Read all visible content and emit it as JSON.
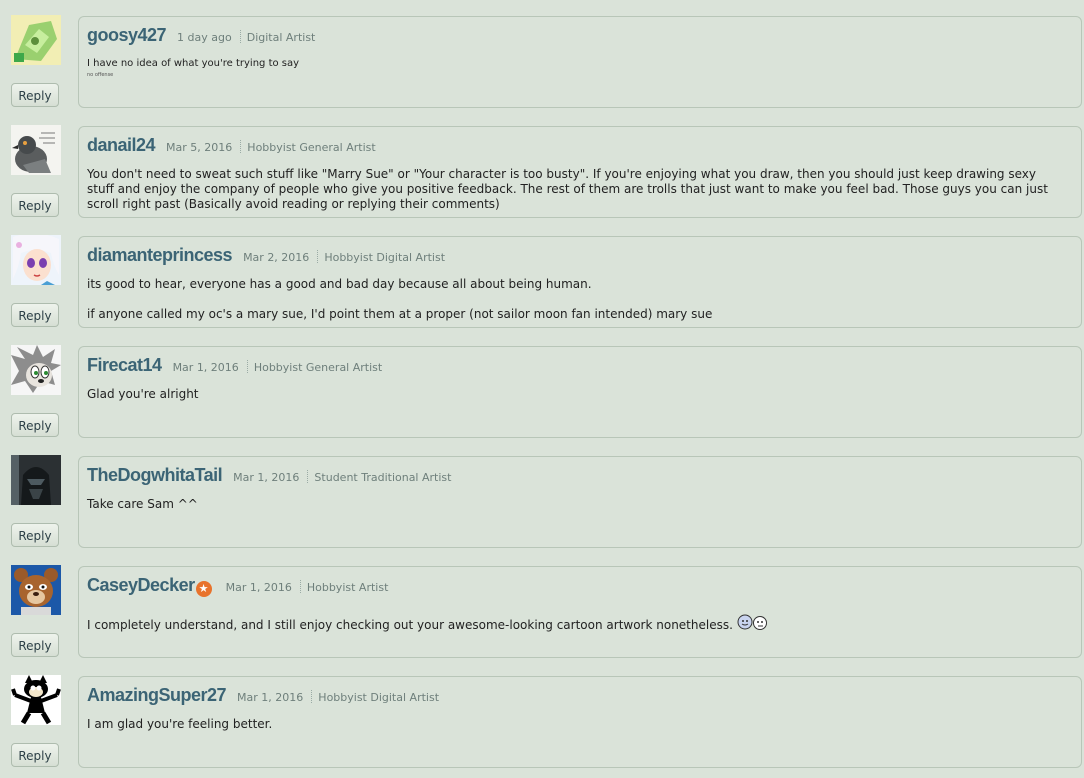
{
  "reply_label": "Reply",
  "comments": [
    {
      "username": "goosy427",
      "date": "1 day ago",
      "role": "Digital Artist",
      "text": "I have no idea of what you're trying to say",
      "subtext": "no offense",
      "avatar": "green-gem-character-avatar"
    },
    {
      "username": "danail24",
      "date": "Mar 5, 2016",
      "role": "Hobbyist General Artist",
      "text": "You don't need to sweat such stuff like \"Marry Sue\" or \"Your character is too busty\". If you're enjoying what you draw, then you should just keep drawing sexy stuff and enjoy the company of people who give you positive feedback. The rest of them are trolls that just want to make you feel bad. Those guys you can just scroll right past (Basically avoid reading or replying their comments)",
      "avatar": "pigeon-avatar"
    },
    {
      "username": "diamanteprincess",
      "date": "Mar 2, 2016",
      "role": "Hobbyist Digital Artist",
      "text": "its good to hear, everyone has a good and bad day because all about being human.",
      "text2": "if anyone called my oc's a mary sue, I'd point them at a proper (not sailor moon fan intended) mary sue",
      "avatar": "anime-girl-avatar"
    },
    {
      "username": "Firecat14",
      "date": "Mar 1, 2016",
      "role": "Hobbyist General Artist",
      "text": "Glad you're alright",
      "avatar": "hedgehog-avatar"
    },
    {
      "username": "TheDogwhitaTail",
      "date": "Mar 1, 2016",
      "role": "Student Traditional Artist",
      "text": "Take care Sam ^^",
      "avatar": "dark-armor-avatar"
    },
    {
      "username": "CaseyDecker",
      "date": "Mar 1, 2016",
      "role": "Hobbyist Artist",
      "text": "I completely understand, and I still enjoy checking out your awesome-looking cartoon artwork nonetheless.",
      "badge": "core-member-star",
      "emoticons": "hug-emoticons",
      "avatar": "bear-avatar"
    },
    {
      "username": "AmazingSuper27",
      "date": "Mar 1, 2016",
      "role": "Hobbyist Digital Artist",
      "text": "I am glad you're feeling better.",
      "avatar": "felix-cat-avatar"
    }
  ]
}
